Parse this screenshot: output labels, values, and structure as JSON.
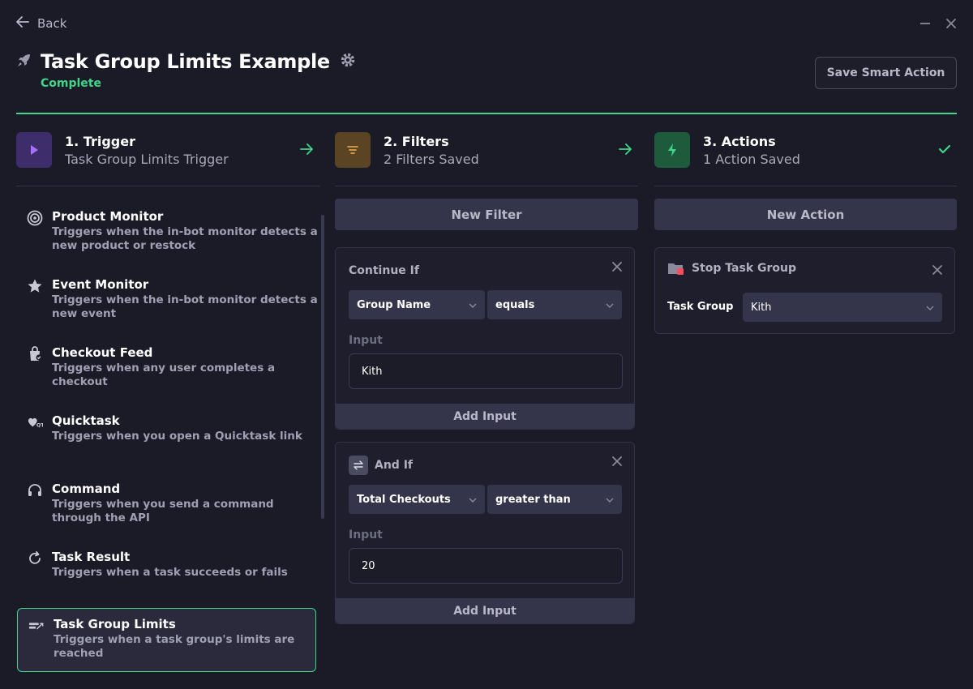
{
  "window": {
    "back_label": "Back",
    "minimize_icon": "minimize-icon",
    "close_icon": "close-icon"
  },
  "header": {
    "title": "Task Group Limits Example",
    "status": "Complete",
    "save_label": "Save Smart Action"
  },
  "colors": {
    "accent": "#3ed68a",
    "background": "#1b1b27",
    "trigger_icon_bg": "#3d2d6b",
    "filters_icon_bg": "#5a4424",
    "actions_icon_bg": "#1e5a3c",
    "stop_badge": "#ff4d5e"
  },
  "steps": [
    {
      "title": "1. Trigger",
      "subtitle": "Task Group Limits Trigger"
    },
    {
      "title": "2. Filters",
      "subtitle": "2 Filters Saved"
    },
    {
      "title": "3. Actions",
      "subtitle": "1 Action Saved"
    }
  ],
  "triggers": [
    {
      "name": "Product Monitor",
      "description": "Triggers when the in-bot monitor detects a new product or restock",
      "icon": "radar-icon"
    },
    {
      "name": "Event Monitor",
      "description": "Triggers when the in-bot monitor detects a new event",
      "icon": "star-icon"
    },
    {
      "name": "Checkout Feed",
      "description": "Triggers when any user completes a checkout",
      "icon": "checkout-icon"
    },
    {
      "name": "Quicktask",
      "description": "Triggers when you open a Quicktask link",
      "icon": "quicktask-icon"
    },
    {
      "name": "Command",
      "description": "Triggers when you send a command through the API",
      "icon": "headset-icon"
    },
    {
      "name": "Task Result",
      "description": "Triggers when a task succeeds or fails",
      "icon": "refresh-icon"
    },
    {
      "name": "Task Group Limits",
      "description": "Triggers when a task group's limits are reached",
      "icon": "limits-icon",
      "selected": true
    }
  ],
  "filters": {
    "new_label": "New Filter",
    "items": [
      {
        "label": "Continue If",
        "field": "Group Name",
        "operator": "equals",
        "input_label": "Input",
        "input_value": "Kith",
        "add_input_label": "Add Input"
      },
      {
        "label": "And If",
        "field": "Total Checkouts",
        "operator": "greater than",
        "input_label": "Input",
        "input_value": "20",
        "add_input_label": "Add Input"
      }
    ]
  },
  "actions": {
    "new_label": "New Action",
    "items": [
      {
        "label": "Stop Task Group",
        "field_label": "Task Group",
        "field_value": "Kith"
      }
    ]
  }
}
